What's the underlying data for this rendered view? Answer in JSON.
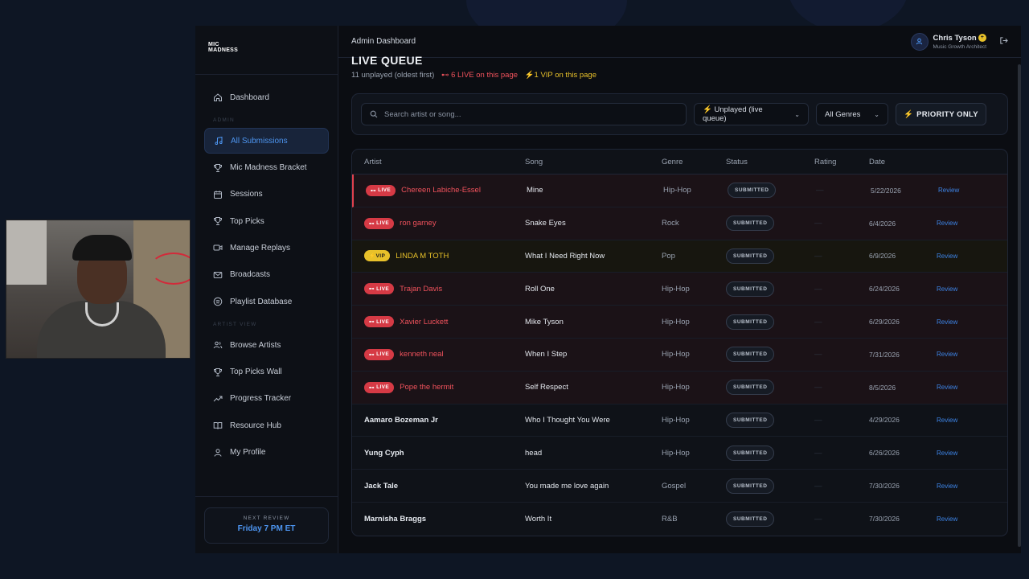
{
  "app": {
    "logo": "MIC MADNESS",
    "page_title": "Admin Dashboard"
  },
  "user": {
    "name": "Chris Tyson",
    "role": "Music Growth Architect",
    "badge_icon": "plus-badge-icon"
  },
  "sidebar": {
    "sections": {
      "admin": "ADMIN",
      "artist_view": "ARTIST VIEW"
    },
    "items": [
      {
        "label": "Dashboard",
        "icon": "home-icon"
      },
      {
        "label": "All Submissions",
        "icon": "music-note-icon",
        "active": true
      },
      {
        "label": "Mic Madness Bracket",
        "icon": "trophy-icon"
      },
      {
        "label": "Sessions",
        "icon": "calendar-icon"
      },
      {
        "label": "Top Picks",
        "icon": "trophy-icon"
      },
      {
        "label": "Manage Replays",
        "icon": "video-icon"
      },
      {
        "label": "Broadcasts",
        "icon": "mail-icon"
      },
      {
        "label": "Playlist Database",
        "icon": "spotify-icon"
      },
      {
        "label": "Browse Artists",
        "icon": "users-icon"
      },
      {
        "label": "Top Picks Wall",
        "icon": "trophy-icon"
      },
      {
        "label": "Progress Tracker",
        "icon": "trending-up-icon"
      },
      {
        "label": "Resource Hub",
        "icon": "book-icon"
      },
      {
        "label": "My Profile",
        "icon": "user-icon"
      }
    ],
    "next_review": {
      "label": "NEXT REVIEW",
      "value": "Friday 7 PM ET"
    }
  },
  "queue": {
    "title": "LIVE QUEUE",
    "subtitle": "11 unplayed (oldest first)",
    "live_count": "6 LIVE on this page",
    "vip_count": "1 VIP on this page"
  },
  "filters": {
    "search_placeholder": "Search artist or song...",
    "status_select": "Unplayed (live queue)",
    "genre_select": "All Genres",
    "priority_button": "PRIORITY ONLY"
  },
  "table": {
    "headers": [
      "Artist",
      "Song",
      "Genre",
      "Status",
      "Rating",
      "Date"
    ],
    "action_label": "Review",
    "rows": [
      {
        "tag": "LIVE",
        "artist": "Chereen Labiche-Essel",
        "song": "Mine",
        "genre": "Hip-Hop",
        "status": "SUBMITTED",
        "rating": "—",
        "date": "5/22/2026"
      },
      {
        "tag": "LIVE",
        "artist": "ron garney",
        "song": "Snake Eyes",
        "genre": "Rock",
        "status": "SUBMITTED",
        "rating": "—",
        "date": "6/4/2026"
      },
      {
        "tag": "VIP",
        "artist": "LINDA M TOTH",
        "song": "What I Need Right Now",
        "genre": "Pop",
        "status": "SUBMITTED",
        "rating": "—",
        "date": "6/9/2026"
      },
      {
        "tag": "LIVE",
        "artist": "Trajan Davis",
        "song": "Roll One",
        "genre": "Hip-Hop",
        "status": "SUBMITTED",
        "rating": "—",
        "date": "6/24/2026"
      },
      {
        "tag": "LIVE",
        "artist": "Xavier Luckett",
        "song": "Mike Tyson",
        "genre": "Hip-Hop",
        "status": "SUBMITTED",
        "rating": "—",
        "date": "6/29/2026"
      },
      {
        "tag": "LIVE",
        "artist": "kenneth neal",
        "song": "When I Step",
        "genre": "Hip-Hop",
        "status": "SUBMITTED",
        "rating": "—",
        "date": "7/31/2026"
      },
      {
        "tag": "LIVE",
        "artist": "Pope the hermit",
        "song": "Self Respect",
        "genre": "Hip-Hop",
        "status": "SUBMITTED",
        "rating": "—",
        "date": "8/5/2026"
      },
      {
        "tag": "",
        "artist": "Aamaro Bozeman Jr",
        "song": "Who I Thought You Were",
        "genre": "Hip-Hop",
        "status": "SUBMITTED",
        "rating": "—",
        "date": "4/29/2026"
      },
      {
        "tag": "",
        "artist": "Yung Cyph",
        "song": "head",
        "genre": "Hip-Hop",
        "status": "SUBMITTED",
        "rating": "—",
        "date": "6/26/2026"
      },
      {
        "tag": "",
        "artist": "Jack Tale",
        "song": "You made me love again",
        "genre": "Gospel",
        "status": "SUBMITTED",
        "rating": "—",
        "date": "7/30/2026"
      },
      {
        "tag": "",
        "artist": "Marnisha Braggs",
        "song": "Worth It",
        "genre": "R&B",
        "status": "SUBMITTED",
        "rating": "—",
        "date": "7/30/2026"
      }
    ]
  },
  "colors": {
    "accent_blue": "#4d95f0",
    "live_red": "#f0525c",
    "vip_yellow": "#e8c12a"
  }
}
